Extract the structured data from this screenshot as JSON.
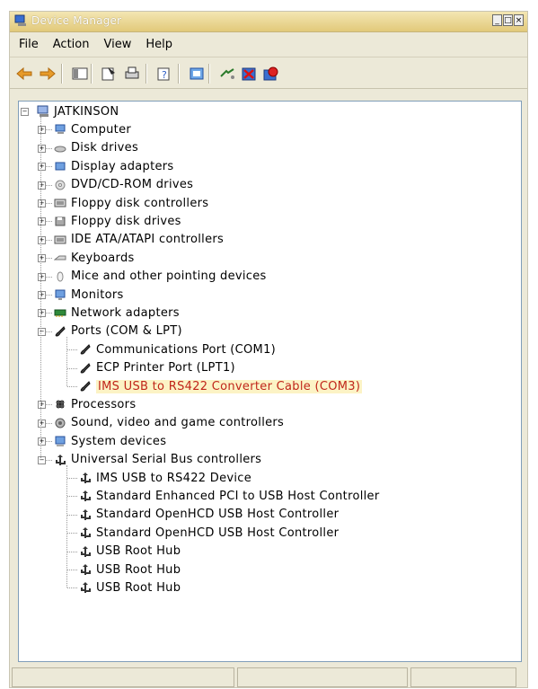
{
  "window": {
    "title": "Device Manager"
  },
  "menu": [
    "File",
    "Action",
    "View",
    "Help"
  ],
  "toolbar": [
    "back-arrow-icon",
    "forward-arrow-icon",
    "show-hide-tree-icon",
    "properties-icon",
    "print-icon",
    "help-icon",
    "scan-hardware-icon",
    "update-driver-icon",
    "uninstall-icon",
    "disable-icon"
  ],
  "tree": {
    "root": "JATKINSON",
    "categories": [
      {
        "label": "Computer",
        "icon": "computer-icon",
        "expanded": false
      },
      {
        "label": "Disk drives",
        "icon": "disk-drive-icon",
        "expanded": false
      },
      {
        "label": "Display adapters",
        "icon": "display-adapter-icon",
        "expanded": false
      },
      {
        "label": "DVD/CD-ROM drives",
        "icon": "dvd-drive-icon",
        "expanded": false
      },
      {
        "label": "Floppy disk controllers",
        "icon": "controller-icon",
        "expanded": false
      },
      {
        "label": "Floppy disk drives",
        "icon": "floppy-drive-icon",
        "expanded": false
      },
      {
        "label": "IDE ATA/ATAPI controllers",
        "icon": "controller-icon",
        "expanded": false
      },
      {
        "label": "Keyboards",
        "icon": "keyboard-icon",
        "expanded": false
      },
      {
        "label": "Mice and other pointing devices",
        "icon": "mouse-icon",
        "expanded": false
      },
      {
        "label": "Monitors",
        "icon": "monitor-icon",
        "expanded": false
      },
      {
        "label": "Network adapters",
        "icon": "network-adapter-icon",
        "expanded": false
      },
      {
        "label": "Ports (COM & LPT)",
        "icon": "port-icon",
        "expanded": true,
        "children": [
          {
            "label": "Communications Port (COM1)",
            "icon": "port-icon"
          },
          {
            "label": "ECP Printer Port (LPT1)",
            "icon": "port-icon"
          },
          {
            "label": "IMS USB to RS422 Converter Cable (COM3)",
            "icon": "port-icon",
            "highlighted": true
          }
        ]
      },
      {
        "label": "Processors",
        "icon": "processor-icon",
        "expanded": false
      },
      {
        "label": "Sound, video and game controllers",
        "icon": "sound-icon",
        "expanded": false
      },
      {
        "label": "System devices",
        "icon": "system-device-icon",
        "expanded": false
      },
      {
        "label": "Universal Serial Bus controllers",
        "icon": "usb-icon",
        "expanded": true,
        "children": [
          {
            "label": "IMS USB to RS422 Device",
            "icon": "usb-icon"
          },
          {
            "label": "Standard Enhanced PCI to USB Host Controller",
            "icon": "usb-icon"
          },
          {
            "label": "Standard OpenHCD USB Host Controller",
            "icon": "usb-icon"
          },
          {
            "label": "Standard OpenHCD USB Host Controller",
            "icon": "usb-icon"
          },
          {
            "label": "USB Root Hub",
            "icon": "usb-icon"
          },
          {
            "label": "USB Root Hub",
            "icon": "usb-icon"
          },
          {
            "label": "USB Root Hub",
            "icon": "usb-icon"
          }
        ]
      }
    ]
  },
  "colors": {
    "highlight_bg": "#fcf3c5",
    "highlight_text": "#c0261a",
    "titlebar": "#e2c97a"
  }
}
